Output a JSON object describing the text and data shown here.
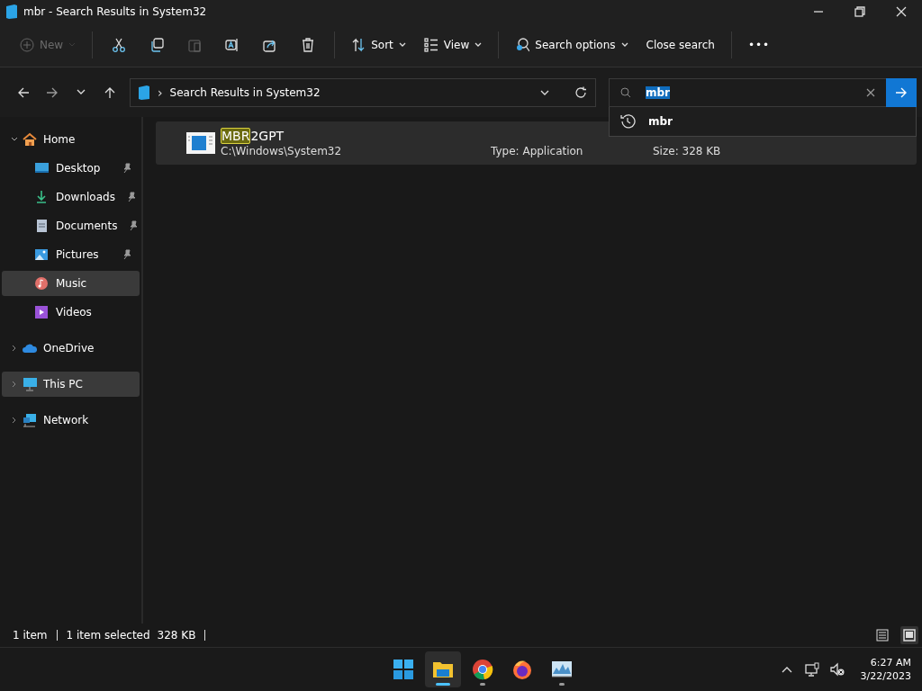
{
  "window": {
    "title": "mbr - Search Results in System32"
  },
  "toolbar": {
    "groups": [
      [
        {
          "kind": "new",
          "label": "New",
          "disabled": true
        }
      ],
      [
        {
          "kind": "cut",
          "disabled": false
        },
        {
          "kind": "copy",
          "disabled": false
        },
        {
          "kind": "paste",
          "disabled": true
        },
        {
          "kind": "rename",
          "disabled": false
        },
        {
          "kind": "share",
          "disabled": false
        },
        {
          "kind": "delete",
          "disabled": false
        }
      ],
      [
        {
          "kind": "sort",
          "label": "Sort",
          "disabled": false
        },
        {
          "kind": "view",
          "label": "View",
          "disabled": false
        }
      ],
      [
        {
          "kind": "search-options",
          "label": "Search options",
          "disabled": false
        },
        {
          "kind": "close-search",
          "label": "Close search",
          "disabled": false
        }
      ],
      [
        {
          "kind": "more",
          "label": "•••",
          "disabled": false
        }
      ]
    ]
  },
  "address": {
    "separator": "›",
    "location": "Search Results in System32"
  },
  "search": {
    "value": "mbr",
    "value_selected": true,
    "suggestions": [
      {
        "text": "mbr"
      }
    ]
  },
  "sidebar": {
    "items": [
      {
        "label": "Home",
        "kind": "home",
        "expanded": true,
        "highlighted": false,
        "children": [
          {
            "label": "Desktop",
            "kind": "desktop",
            "pinned": true,
            "highlighted": false
          },
          {
            "label": "Downloads",
            "kind": "downloads",
            "pinned": true,
            "highlighted": false
          },
          {
            "label": "Documents",
            "kind": "documents",
            "pinned": true,
            "highlighted": false
          },
          {
            "label": "Pictures",
            "kind": "pictures",
            "pinned": true,
            "highlighted": false
          },
          {
            "label": "Music",
            "kind": "music",
            "pinned": false,
            "highlighted": true
          },
          {
            "label": "Videos",
            "kind": "videos",
            "pinned": false,
            "highlighted": false
          }
        ]
      },
      {
        "label": "OneDrive",
        "kind": "cloud",
        "expanded": false,
        "highlighted": false
      },
      {
        "label": "This PC",
        "kind": "pc",
        "expanded": false,
        "highlighted": true
      },
      {
        "label": "Network",
        "kind": "network",
        "expanded": false,
        "highlighted": false
      }
    ]
  },
  "results": [
    {
      "name_match": "MBR",
      "name_rest": "2GPT",
      "path": "C:\\Windows\\System32",
      "type": "Type: Application",
      "size": "Size: 328 KB",
      "selected": true
    }
  ],
  "status_bar": {
    "count": "1 item",
    "selection": "1 item selected",
    "size": "328 KB",
    "view_modes": [
      {
        "kind": "details",
        "selected": false
      },
      {
        "kind": "tiles",
        "selected": true
      }
    ]
  },
  "taskbar": {
    "apps": [
      {
        "kind": "start",
        "running": false,
        "active": false
      },
      {
        "kind": "explorer",
        "running": true,
        "active": true
      },
      {
        "kind": "chrome",
        "running": true,
        "active": false
      },
      {
        "kind": "firefox",
        "running": false,
        "active": false
      },
      {
        "kind": "monitor",
        "running": true,
        "active": false
      }
    ],
    "tray": {
      "time": "6:27 AM",
      "date": "3/22/2023"
    }
  }
}
